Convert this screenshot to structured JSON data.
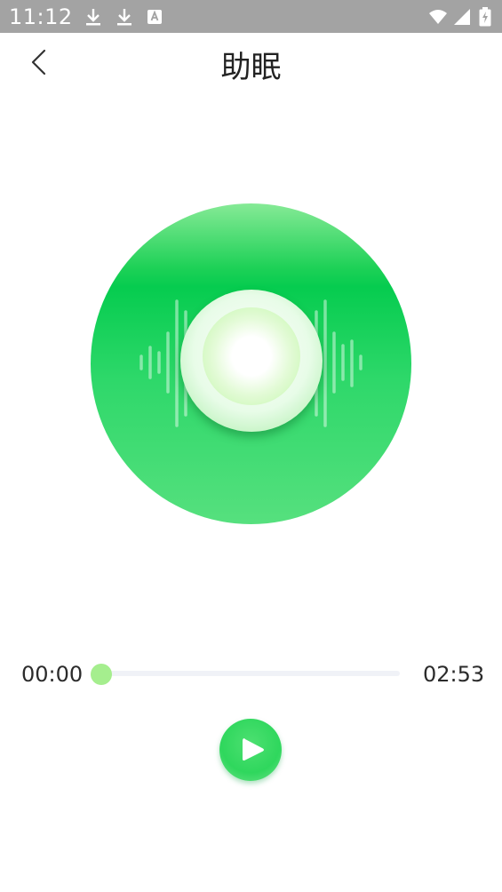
{
  "status_bar": {
    "time": "11:12",
    "left_icons": [
      "download-icon",
      "download-icon",
      "text-a-icon"
    ],
    "right_icons": [
      "wifi-icon",
      "signal-icon",
      "battery-charging-icon"
    ],
    "background": "#a3a3a3"
  },
  "header": {
    "title": "助眠",
    "back_icon": "chevron-left-icon"
  },
  "player": {
    "disc_colors": {
      "top": "#86ea96",
      "band": "#06cc4f",
      "bottom": "#56e07e"
    },
    "current_time": "00:00",
    "total_time": "02:53",
    "progress": 0,
    "accent": "#a5ee8e",
    "play_button_color": "#2fd75d",
    "play_icon": "play-icon"
  }
}
